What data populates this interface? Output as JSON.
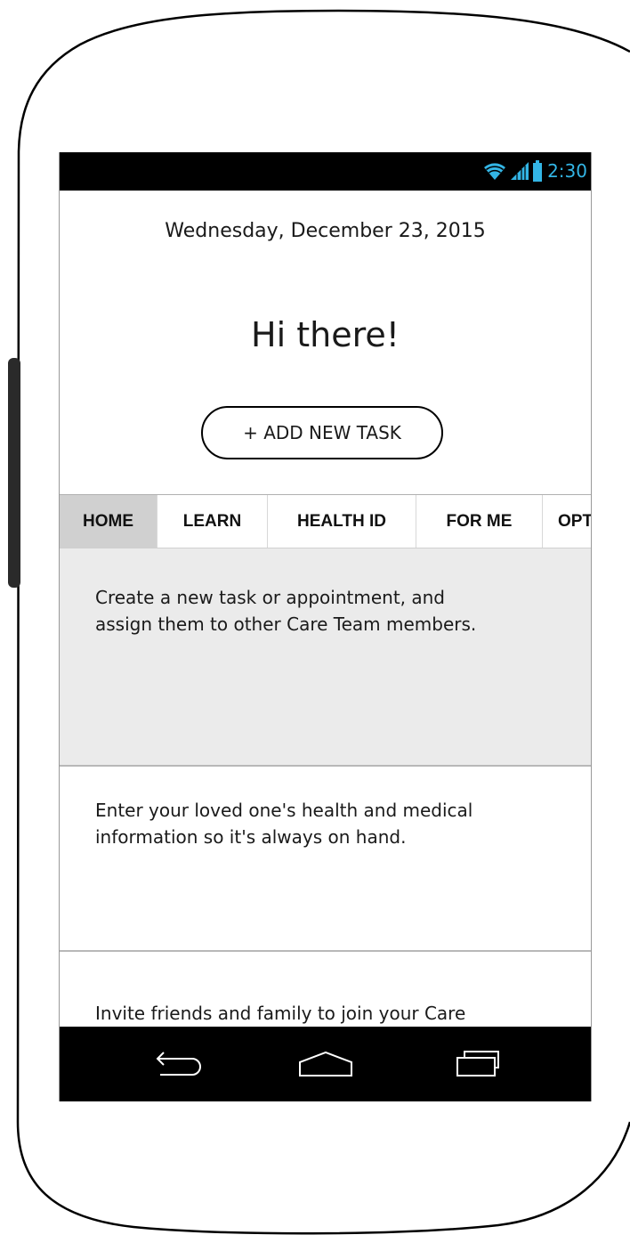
{
  "status_bar": {
    "time": "2:30",
    "icons": [
      "wifi-icon",
      "signal-icon",
      "battery-icon"
    ]
  },
  "home": {
    "date": "Wednesday, December 23, 2015",
    "greeting": "Hi there!",
    "add_task_label": "+ ADD NEW TASK"
  },
  "tabs": [
    {
      "label": "HOME",
      "active": true
    },
    {
      "label": "LEARN",
      "active": false
    },
    {
      "label": "HEALTH ID",
      "active": false
    },
    {
      "label": "FOR ME",
      "active": false
    },
    {
      "label": "OPTIONS",
      "active": false
    }
  ],
  "cards": [
    {
      "text": "Create a new task or appointment, and assign them to other Care Team members."
    },
    {
      "text": "Enter your loved one's health and medical information so it's always on hand."
    },
    {
      "text": "Invite friends and family to join your Care Team."
    }
  ],
  "nav_bar": {
    "icons": [
      "back-icon",
      "home-icon",
      "recent-apps-icon"
    ]
  },
  "colors": {
    "clock": "#33b5e5",
    "active_tab": "#d0d0d0",
    "highlight_card": "#ebebeb"
  }
}
